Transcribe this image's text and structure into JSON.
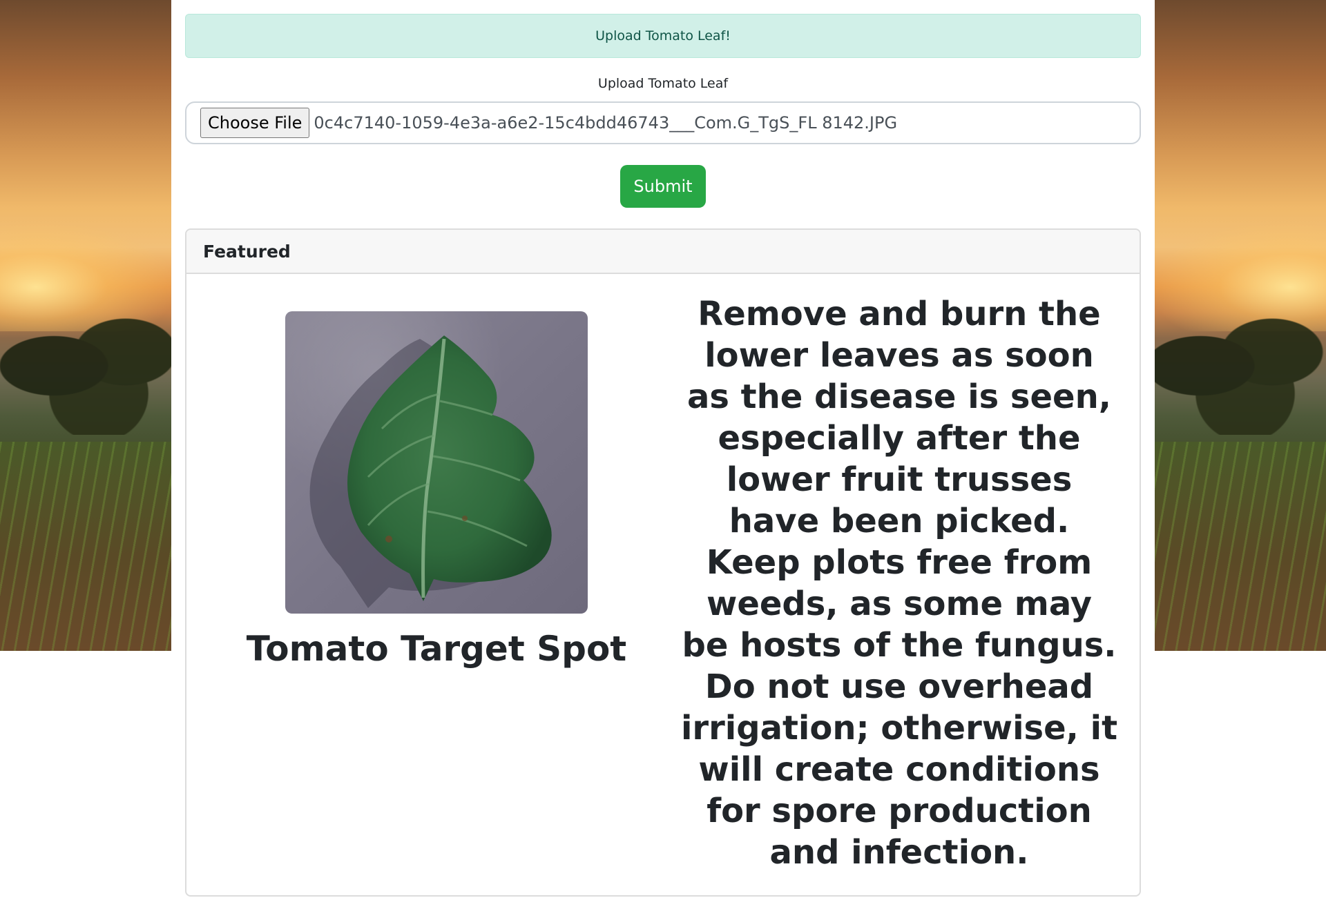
{
  "alert": {
    "message": "Upload Tomato Leaf!"
  },
  "upload": {
    "label": "Upload Tomato Leaf",
    "choose_button_label": "Choose File",
    "file_name": "0c4c7140-1059-4e3a-a6e2-15c4bdd46743___Com.G_TgS_FL 8142.JPG"
  },
  "submit": {
    "label": "Submit"
  },
  "card": {
    "header": "Featured",
    "disease_name": "Tomato Target Spot",
    "treatment": "Remove and burn the lower leaves as soon as the disease is seen, especially after the lower fruit trusses have been picked. Keep plots free from weeds, as some may be hosts of the fungus. Do not use overhead irrigation; otherwise, it will create conditions for spore production and infection."
  },
  "colors": {
    "alert_bg": "#d1f0e8",
    "alert_text": "#0f5446",
    "submit_bg": "#28a745"
  }
}
